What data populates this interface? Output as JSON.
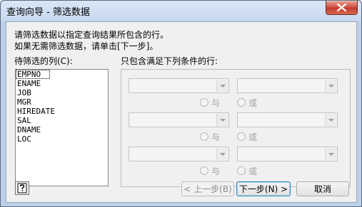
{
  "window": {
    "title": "查询向导 - 筛选数据"
  },
  "instructions": {
    "line1": "请筛选数据以指定查询结果所包含的行。",
    "line2": "如果无需筛选数据，请单击[下一步]。"
  },
  "columns": {
    "label": "待筛选的列(C):",
    "items": [
      "EMPNO",
      "ENAME",
      "JOB",
      "MGR",
      "HIREDATE",
      "SAL",
      "DNAME",
      "LOC"
    ],
    "selected_index": 0
  },
  "conditions": {
    "label": "只包含满足下列条件的行:",
    "and_label": "与",
    "or_label": "或"
  },
  "buttons": {
    "back": "< 上一步(B)",
    "next": "下一步(N) >",
    "cancel": "取消"
  },
  "icons": {
    "help": "help-question-icon",
    "close": "close-icon"
  },
  "colors": {
    "close_button": "#c23a2c",
    "dialog_bg": "#f0f0f0"
  }
}
